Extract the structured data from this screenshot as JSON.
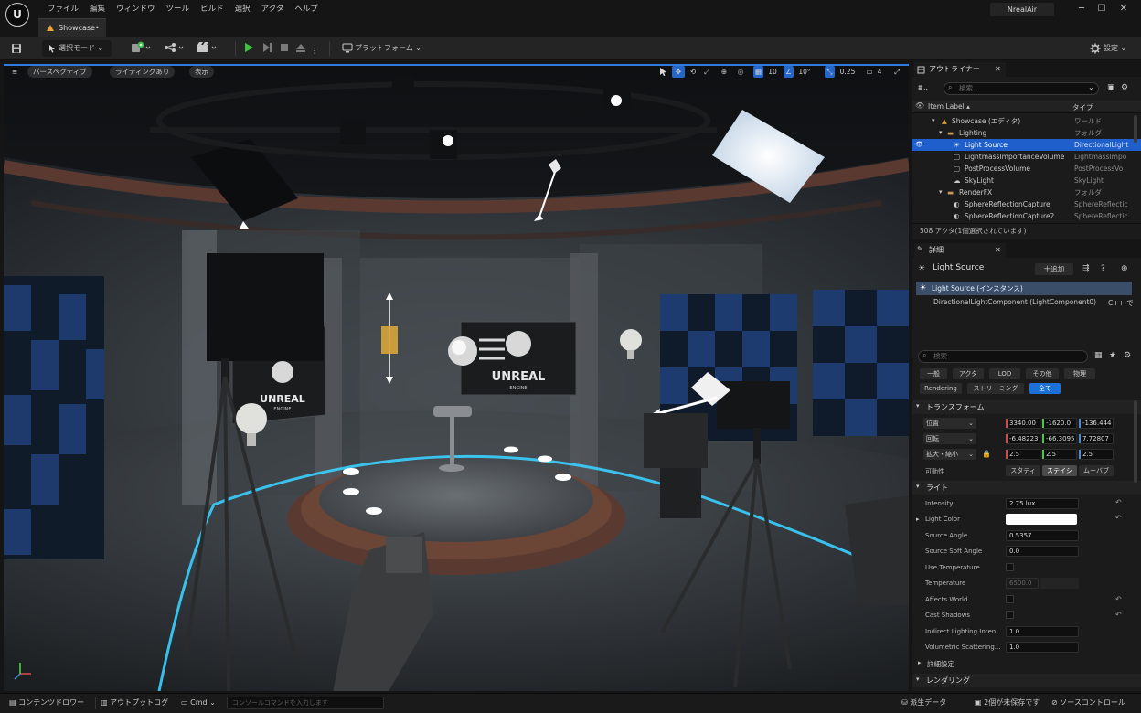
{
  "app": {
    "logo": "U",
    "project": "NrealAir"
  },
  "menu": [
    "ファイル",
    "編集",
    "ウィンドウ",
    "ツール",
    "ビルド",
    "選択",
    "アクタ",
    "ヘルプ"
  ],
  "window_controls": [
    "─",
    "☐",
    "✕"
  ],
  "document_tab": {
    "label": "Showcase•"
  },
  "toolbar": {
    "save_icon": "save-icon",
    "mode_label": "選択モード",
    "platform_label": "プラットフォーム",
    "settings_label": "設定"
  },
  "viewport": {
    "menu_icon": "≡",
    "perspective_label": "パースペクティブ",
    "lighting_label": "ライティングあり",
    "show_label": "表示",
    "grid_snap": "10",
    "rotate_snap": "10°",
    "scale_snap": "0.25",
    "camera_speed": "4",
    "signs": {
      "main": "UNREAL",
      "main_sub": "ENGINE",
      "left": "UNREAL",
      "left_sub": "ENGINE"
    }
  },
  "outliner": {
    "tab_label": "アウトライナー",
    "search_placeholder": "検索...",
    "col_label": "Item Label ▴",
    "col_type": "タイプ",
    "rows": [
      {
        "label": "Showcase (エディタ)",
        "type": "ワールド"
      },
      {
        "label": "Lighting",
        "type": "フォルダ"
      },
      {
        "label": "Light Source",
        "type": "DirectionalLight"
      },
      {
        "label": "LightmassImportanceVolume",
        "type": "LightmassImpo"
      },
      {
        "label": "PostProcessVolume",
        "type": "PostProcessVo"
      },
      {
        "label": "SkyLight",
        "type": "SkyLight"
      },
      {
        "label": "RenderFX",
        "type": "フォルダ"
      },
      {
        "label": "SphereReflectionCapture",
        "type": "SphereReflectic"
      },
      {
        "label": "SphereReflectionCapture2",
        "type": "SphereReflectic"
      }
    ],
    "status": "508 アクタ(1個選択されています)"
  },
  "details": {
    "tab_label": "詳細",
    "actor_name": "Light Source",
    "add_label": "十追加",
    "instance_label": "Light Source (インスタンス)",
    "component_label": "DirectionalLightComponent (LightComponent0)",
    "component_cpp": "C++ で",
    "search_placeholder": "検索",
    "categories_row1": [
      "一般",
      "アクタ",
      "LOD",
      "その他",
      "物理"
    ],
    "categories_row2": [
      "Rendering",
      "ストリーミング",
      "全て"
    ],
    "transform": {
      "section": "トランスフォーム",
      "location_label": "位置",
      "location": [
        "3340.00",
        "-1620.0",
        "-136.444"
      ],
      "rotation_label": "回転",
      "rotation": [
        "-6.48223",
        "-66.3095",
        "7.72807"
      ],
      "scale_label": "拡大・縮小",
      "scale": [
        "2.5",
        "2.5",
        "2.5"
      ],
      "mobility_label": "可動性",
      "mobility": [
        "スタティ",
        "ステイシ",
        "ムーバブ"
      ]
    },
    "light": {
      "section": "ライト",
      "intensity_label": "Intensity",
      "intensity": "2.75 lux",
      "color_label": "Light Color",
      "source_angle_label": "Source Angle",
      "source_angle": "0.5357",
      "soft_angle_label": "Source Soft Angle",
      "soft_angle": "0.0",
      "use_temp_label": "Use Temperature",
      "temperature_label": "Temperature",
      "temperature": "6500.0",
      "affects_world_label": "Affects World",
      "cast_shadows_label": "Cast Shadows",
      "indirect_label": "Indirect Lighting Inten...",
      "indirect": "1.0",
      "volumetric_label": "Volumetric Scattering...",
      "volumetric": "1.0"
    },
    "advanced_label": "詳細設定",
    "rendering_section": "レンダリング"
  },
  "statusbar": {
    "content_drawer": "コンテンツドロワー",
    "output_log": "アウトプットログ",
    "cmd": "Cmd",
    "cmd_placeholder": "コンソールコマンドを入力します",
    "derived_data": "派生データ",
    "unsaved": "2個が未保存です",
    "source_control": "ソースコントロール"
  },
  "colors": {
    "accent": "#2f7be0",
    "selection": "#1e5fcc",
    "neon": "#3ad0ff"
  }
}
